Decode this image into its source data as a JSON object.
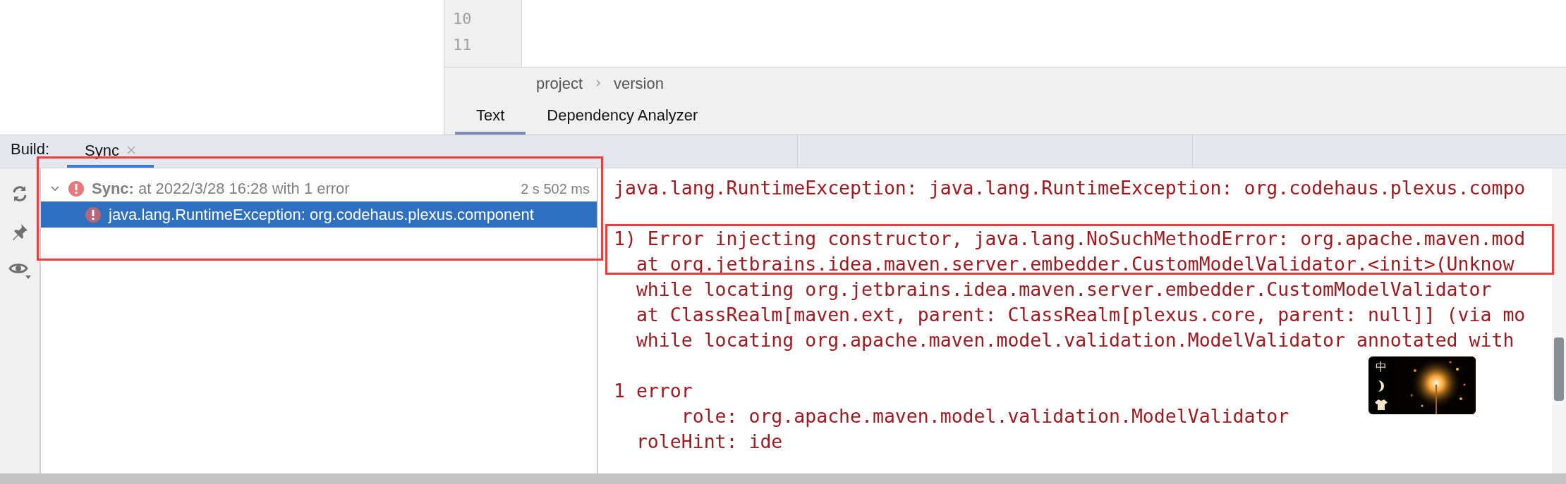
{
  "editor": {
    "line_numbers": [
      "10",
      "11"
    ],
    "breadcrumb": [
      "project",
      "version"
    ],
    "tabs": [
      {
        "label": "Text",
        "selected": true
      },
      {
        "label": "Dependency Analyzer",
        "selected": false
      }
    ]
  },
  "build_panel": {
    "label": "Build:",
    "tabs": [
      {
        "label": "Sync",
        "selected": true
      }
    ],
    "tree": [
      {
        "title": "**Sync:** at 2022/3/28 16:28 with 1 error",
        "duration": "2 s 502 ms",
        "expanded": true,
        "selected": false,
        "children": [
          {
            "title": "java.lang.RuntimeException: org.codehaus.plexus.component",
            "selected": true
          }
        ]
      }
    ],
    "console": [
      [
        "java.lang.RuntimeException: java.lang.RuntimeException: org.codehaus.plexus.compo"
      ],
      [
        "1) Error injecting constructor, java.lang.NoSuchMethodError: org.apache.maven.mod",
        "  at org.jetbrains.idea.maven.server.embedder.CustomModelValidator.<init>(Unknow",
        "  while locating org.jetbrains.idea.maven.server.embedder.CustomModelValidator",
        "  at ClassRealm[maven.ext, parent: ClassRealm[plexus.core, parent: null]] (via mo",
        "  while locating org.apache.maven.model.validation.ModelValidator annotated with"
      ],
      [
        "1 error",
        "      role: org.apache.maven.model.validation.ModelValidator",
        "  roleHint: ide"
      ]
    ]
  },
  "overlay_widget": {
    "language": "中"
  }
}
